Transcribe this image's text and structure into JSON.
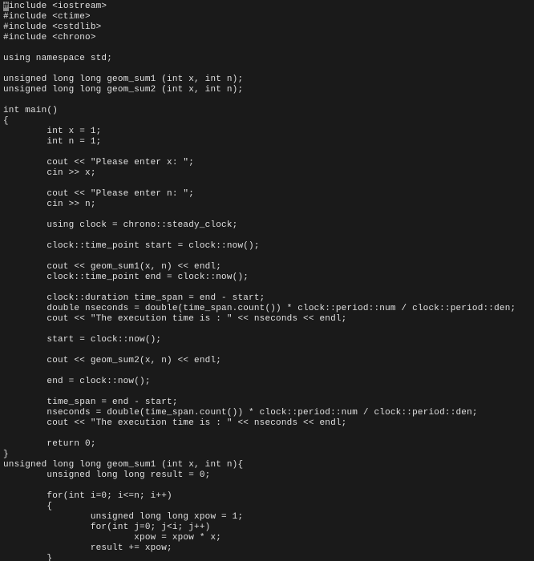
{
  "code": {
    "lines": [
      "include <iostream>",
      "#include <ctime>",
      "#include <cstdlib>",
      "#include <chrono>",
      "",
      "using namespace std;",
      "",
      "unsigned long long geom_sum1 (int x, int n);",
      "unsigned long long geom_sum2 (int x, int n);",
      "",
      "int main()",
      "{",
      "        int x = 1;",
      "        int n = 1;",
      "",
      "        cout << \"Please enter x: \";",
      "        cin >> x;",
      "",
      "        cout << \"Please enter n: \";",
      "        cin >> n;",
      "",
      "        using clock = chrono::steady_clock;",
      "",
      "        clock::time_point start = clock::now();",
      "",
      "        cout << geom_sum1(x, n) << endl;",
      "        clock::time_point end = clock::now();",
      "",
      "        clock::duration time_span = end - start;",
      "        double nseconds = double(time_span.count()) * clock::period::num / clock::period::den;",
      "        cout << \"The execution time is : \" << nseconds << endl;",
      "",
      "        start = clock::now();",
      "",
      "        cout << geom_sum2(x, n) << endl;",
      "",
      "        end = clock::now();",
      "",
      "        time_span = end - start;",
      "        nseconds = double(time_span.count()) * clock::period::num / clock::period::den;",
      "        cout << \"The execution time is : \" << nseconds << endl;",
      "",
      "        return 0;",
      "}",
      "unsigned long long geom_sum1 (int x, int n){",
      "        unsigned long long result = 0;",
      "",
      "        for(int i=0; i<=n; i++)",
      "        {",
      "                unsigned long long xpow = 1;",
      "                for(int j=0; j<i; j++)",
      "                        xpow = xpow * x;",
      "                result += xpow;",
      "        }"
    ],
    "cursor_char": "#"
  }
}
